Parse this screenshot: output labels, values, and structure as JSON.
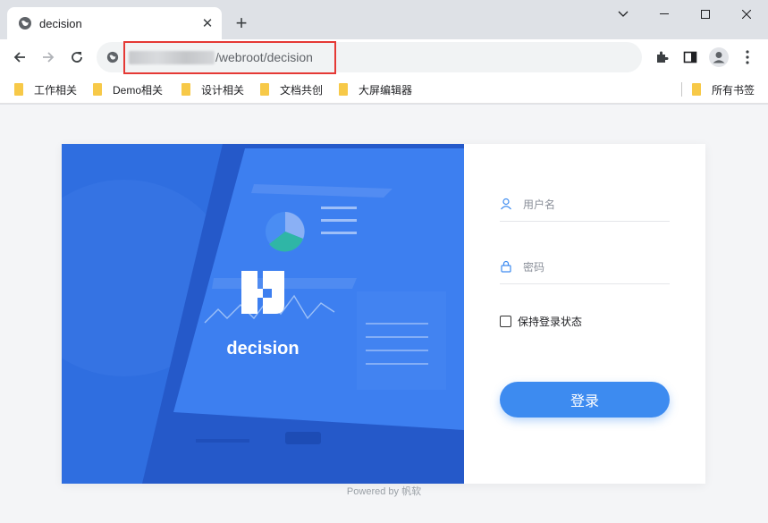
{
  "browser": {
    "tab_title": "decision",
    "tab_close": "✕",
    "new_tab": "+",
    "url_path": "/webroot/decision",
    "icons": {
      "favicon": "globe-icon",
      "back": "arrow-left-icon",
      "forward": "arrow-right-icon",
      "reload": "reload-icon",
      "site_info": "globe-icon",
      "extensions": "puzzle-icon",
      "sidepanel": "side-panel-icon",
      "profile": "profile-icon",
      "menu": "kebab-menu-icon"
    },
    "window_controls": {
      "minimize": "—",
      "maximize": "☐",
      "close": "✕",
      "dropdown": "⌄"
    }
  },
  "bookmarks": [
    {
      "label": "工作相关"
    },
    {
      "label": "Demo相关"
    },
    {
      "label": "设计相关"
    },
    {
      "label": "文档共创"
    },
    {
      "label": "大屏编辑器"
    }
  ],
  "bookmarks_all": "所有书签",
  "login": {
    "brand": "decision",
    "username_placeholder": "用户名",
    "password_placeholder": "密码",
    "remember_label": "保持登录状态",
    "submit_label": "登录",
    "footer": "Powered by 帆软"
  },
  "colors": {
    "accent": "#3d8bf0",
    "hero_blue": "#2f6ee0",
    "highlight_red": "#e53935",
    "folder_yellow": "#f7c948"
  }
}
